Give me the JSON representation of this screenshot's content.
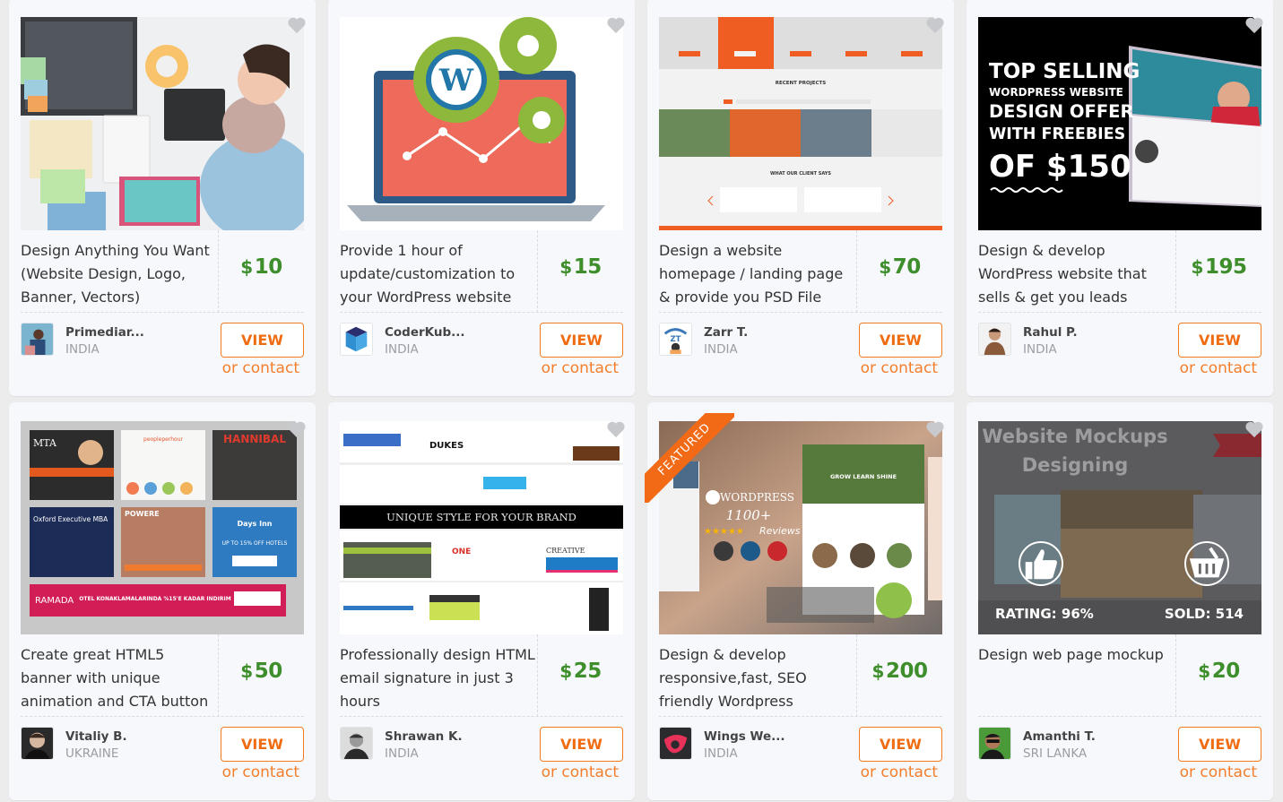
{
  "colors": {
    "page_bg": "#ececed",
    "card_bg": "#f6f8fc",
    "price_green": "#3e8e2c",
    "accent_orange": "#f06c12",
    "featured_ribbon": "#f26a16",
    "heart_gray": "#c8c9cc"
  },
  "common": {
    "view_label": "VIEW",
    "contact_label": "or contact",
    "currency": "$"
  },
  "cards": [
    {
      "title": "Design Anything You Want (Website Design, Logo, Banner, Vectors)",
      "price": "10",
      "seller_name": "Primediar...",
      "seller_country": "INDIA",
      "image": "designer-at-desk-photo",
      "featured": false
    },
    {
      "title": "Provide 1 hour of update/customization to your WordPress website",
      "price": "15",
      "seller_name": "CoderKub...",
      "seller_country": "INDIA",
      "image": "wordpress-laptop-gears",
      "featured": false
    },
    {
      "title": "Design a website homepage / landing page & provide you PSD File",
      "price": "70",
      "seller_name": "Zarr T.",
      "seller_country": "INDIA",
      "image": "orange-website-mockup",
      "image_text": {
        "recent_projects": "RECENT PROJECTS",
        "client_says": "WHAT OUR CLIENT SAYS"
      },
      "featured": false
    },
    {
      "title": "Design & develop WordPress website that sells & get you leads",
      "price": "195",
      "seller_name": "Rahul P.",
      "seller_country": "INDIA",
      "image": "top-selling-wordpress-offer",
      "image_text": {
        "line1": "TOP SELLING",
        "line2": "WORDPRESS WEBSITE",
        "line3": "DESIGN OFFER",
        "line4": "WITH FREEBIES",
        "line5": "OF $150"
      },
      "featured": false
    },
    {
      "title": "Create great HTML5 banner with unique animation and CTA button",
      "price": "50",
      "seller_name": "Vitaliy B.",
      "seller_country": "UKRAINE",
      "image": "banner-ads-collage",
      "image_text": {
        "mta": "MTA",
        "pph": "peopleperhour",
        "hannibal": "HANNIBAL",
        "oxford": "Oxford Executive MBA",
        "powere": "POWERE",
        "daysinn": "Days Inn",
        "daysinn_offer": "UP TO 15% OFF HOTELS",
        "ramada": "RAMADA",
        "ramada_offer": "OTEL KONAKLAMALARINDA %15'E KADAR INDIRIM"
      },
      "featured": false
    },
    {
      "title": "Professionally design HTML email signature in just 3 hours",
      "price": "25",
      "seller_name": "Shrawan K.",
      "seller_country": "INDIA",
      "image": "email-signatures-collage",
      "image_text": {
        "banner": "UNIQUE STYLE FOR YOUR BRAND",
        "dukes": "DUKES",
        "one": "ONE",
        "creative": "CREATIVE"
      },
      "featured": false
    },
    {
      "title": "Design & develop responsive,fast, SEO friendly Wordpress",
      "price": "200",
      "seller_name": "Wings We...",
      "seller_country": "INDIA",
      "image": "wordpress-reviews-mockup",
      "image_text": {
        "brand": "WORDPRESS",
        "count": "1100+",
        "reviews": "Reviews",
        "tagline": "GROW LEARN SHINE"
      },
      "featured": true,
      "featured_label": "FEATURED"
    },
    {
      "title": "Design web page mockup",
      "price": "20",
      "seller_name": "Amanthi T.",
      "seller_country": "SRI LANKA",
      "image": "website-mockups-designing",
      "image_text": {
        "line1": "Website Mockups",
        "line2": "Designing"
      },
      "featured": false,
      "hover_stats": {
        "rating_label": "RATING: 96%",
        "rating_percent": 96,
        "sold_label": "SOLD: 514",
        "sold_count": 514
      }
    }
  ]
}
